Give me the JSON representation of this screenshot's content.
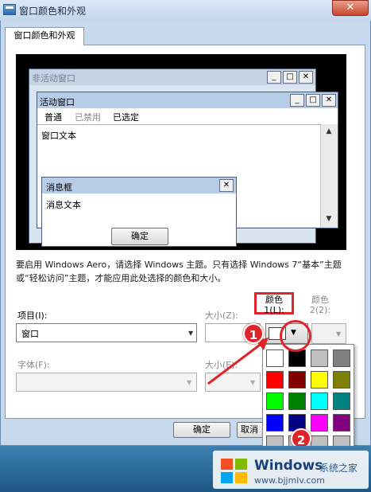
{
  "window": {
    "title": "窗口颜色和外观",
    "close_label": "✕"
  },
  "tab": {
    "label": "窗口颜色和外观"
  },
  "preview": {
    "inactive_title": "非活动窗口",
    "active_title": "活动窗口",
    "menu": [
      "普通",
      "已禁用",
      "已选定"
    ],
    "window_text": "窗口文本",
    "msgbox_title": "消息框",
    "msgbox_text": "消息文本",
    "msgbox_ok": "确定",
    "ctl": {
      "min": "_",
      "max": "□",
      "close": "✕"
    }
  },
  "description": "要启用 Windows Aero，请选择 Windows 主题。只有选择 Windows 7“基本”主题或“轻松访问”主题，才能应用此处选择的颜色和大小。",
  "fields": {
    "item_label": "项目(I):",
    "item_value": "窗口",
    "size_label": "大小(Z):",
    "color1_label": "颜色 1(L):",
    "color2_label": "颜色 2(2):",
    "font_label": "字体(F):",
    "size2_label": "大小(E):"
  },
  "buttons": {
    "ok": "确定",
    "cancel": "取消"
  },
  "palette_colors": [
    "#ffffff",
    "#000000",
    "#c0c0c0",
    "#808080",
    "#ff0000",
    "#800000",
    "#ffff00",
    "#808000",
    "#00ff00",
    "#008000",
    "#00ffff",
    "#008080",
    "#0000ff",
    "#000080",
    "#ff00ff",
    "#800080",
    "#c0c0c0",
    "#c0c0c0",
    "#c0c0c0",
    "#c0c0c0"
  ],
  "annotations": {
    "step1": "1",
    "step2": "2"
  },
  "watermark": {
    "brand": "Windows",
    "sub": "系统之家",
    "url": "www.bjjmlv.com"
  }
}
